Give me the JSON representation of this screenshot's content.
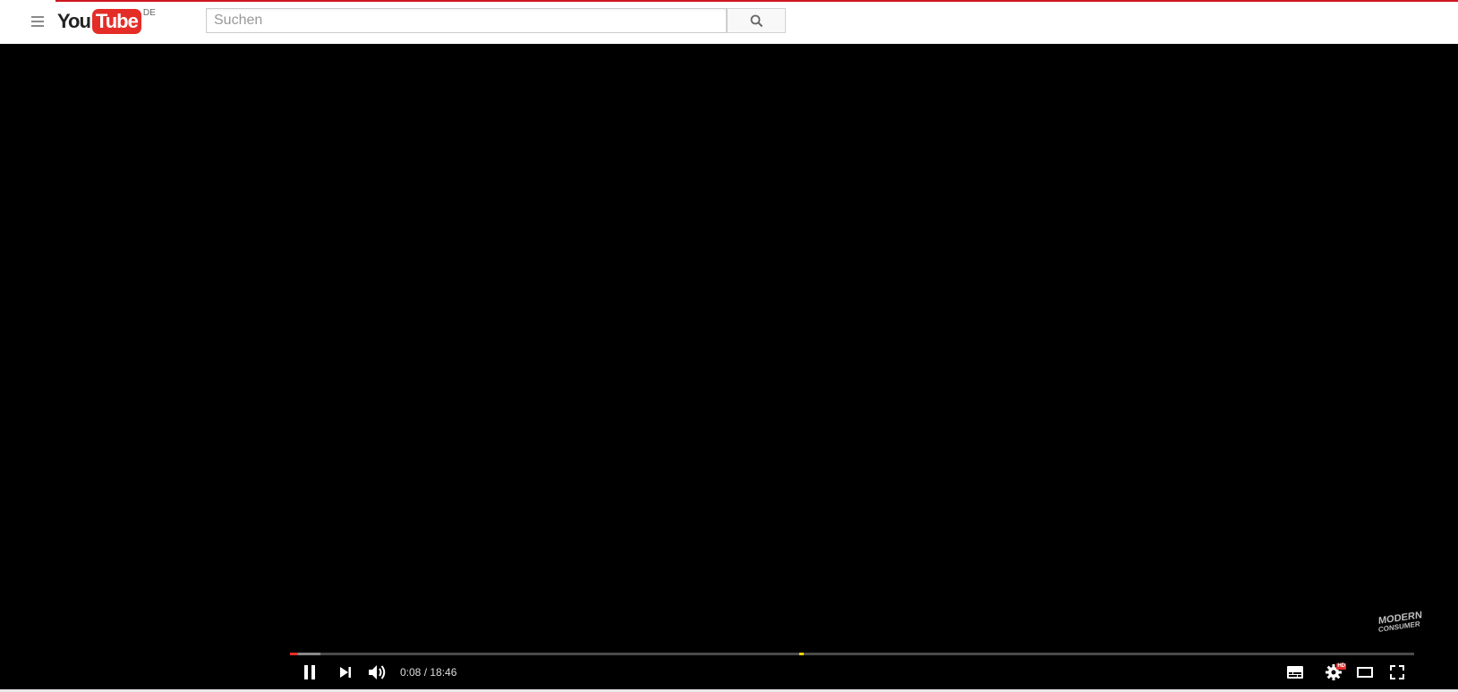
{
  "masthead": {
    "logo_you": "You",
    "logo_tube": "Tube",
    "logo_country": "DE",
    "search": {
      "placeholder": "Suchen",
      "value": ""
    }
  },
  "player": {
    "watermark_line1": "MODERN",
    "watermark_line2": "CONSUMER",
    "time_current": "0:08",
    "time_separator": " / ",
    "time_total": "18:46",
    "progress_played_fraction": 0.007,
    "progress_loaded_fraction": 0.027,
    "hd_badge": "HD"
  },
  "colors": {
    "brand_red": "#e52d27",
    "marker_yellow": "#f5d300",
    "player_bg": "#000000"
  }
}
